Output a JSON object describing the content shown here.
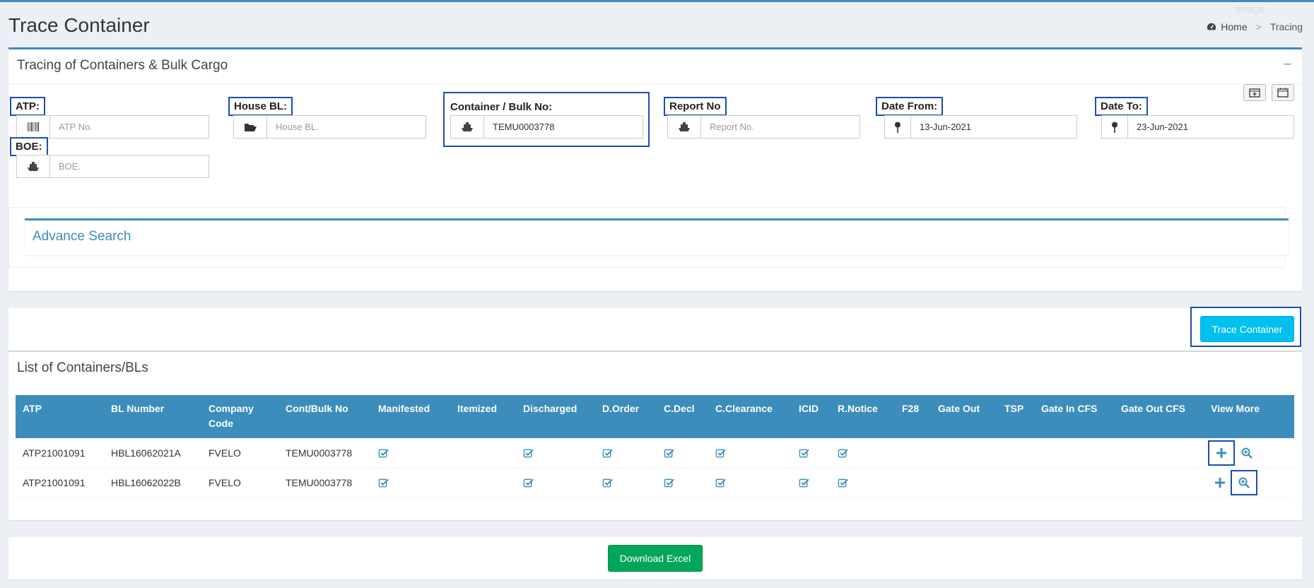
{
  "header": {
    "title": "Trace Container",
    "faint_label": "Image",
    "breadcrumb": {
      "home": "Home",
      "current": "Tracing"
    }
  },
  "search_box": {
    "title": "Tracing of Containers & Bulk Cargo",
    "collapse_symbol": "−",
    "fields": {
      "atp": {
        "label": "ATP:",
        "placeholder": "ATP No.",
        "value": "",
        "icon": "barcode-icon"
      },
      "house_bl": {
        "label": "House BL:",
        "placeholder": "House BL.",
        "value": "",
        "icon": "folder-open-icon"
      },
      "container": {
        "label": "Container / Bulk No:",
        "placeholder": "",
        "value": "TEMU0003778",
        "icon": "ship-icon"
      },
      "report_no": {
        "label": "Report No",
        "placeholder": "Report No.",
        "value": "",
        "icon": "ship-icon"
      },
      "date_from": {
        "label": "Date From:",
        "placeholder": "",
        "value": "13-Jun-2021",
        "icon": "pin-icon"
      },
      "date_to": {
        "label": "Date To:",
        "placeholder": "",
        "value": "23-Jun-2021",
        "icon": "pin-icon"
      },
      "boe": {
        "label": "BOE:",
        "placeholder": "BOE.",
        "value": "",
        "icon": "ship-icon"
      }
    },
    "advance_search": "Advance Search"
  },
  "actions": {
    "trace_button": "Trace Container",
    "download_button": "Download Excel"
  },
  "list": {
    "title": "List of Containers/BLs",
    "columns": [
      "ATP",
      "BL Number",
      "Company Code",
      "Cont/Bulk No",
      "Manifested",
      "Itemized",
      "Discharged",
      "D.Order",
      "C.Decl",
      "C.Clearance",
      "ICID",
      "R.Notice",
      "F28",
      "Gate Out",
      "TSP",
      "Gate In CFS",
      "Gate Out CFS",
      "View More"
    ],
    "rows": [
      {
        "atp": "ATP21001091",
        "bl": "HBL16062021A",
        "company": "FVELO",
        "cont": "TEMU0003778",
        "checks": [
          true,
          false,
          true,
          true,
          true,
          true,
          true,
          true,
          false,
          false,
          false,
          false,
          false
        ]
      },
      {
        "atp": "ATP21001091",
        "bl": "HBL16062022B",
        "company": "FVELO",
        "cont": "TEMU0003778",
        "checks": [
          true,
          false,
          true,
          true,
          true,
          true,
          true,
          true,
          false,
          false,
          false,
          false,
          false
        ]
      }
    ]
  },
  "colors": {
    "primary": "#3c8dbc",
    "info": "#00c0ef",
    "success": "#00a65a",
    "highlight": "#1a4db3"
  }
}
